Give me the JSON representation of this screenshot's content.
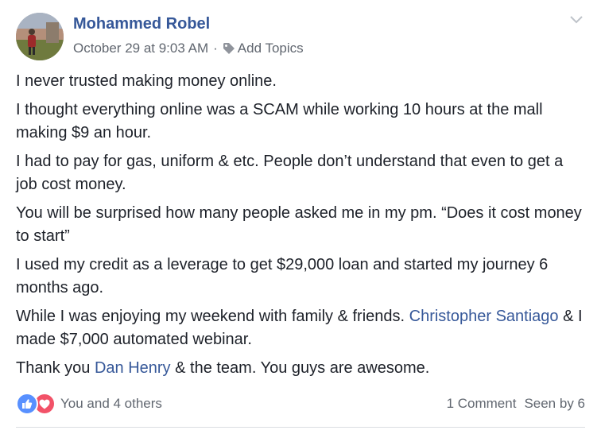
{
  "post": {
    "author": "Mohammed Robel",
    "timestamp": "October 29 at 9:03 AM",
    "separator": "·",
    "add_topics": "Add Topics",
    "menu_icon": "chevron-down-icon",
    "paragraphs": [
      "I never trusted making money online.",
      "I thought everything online was a SCAM while working 10 hours at the mall making $9 an hour.",
      "I had to pay for gas, uniform & etc. People don’t understand that even to get a job cost money.",
      "You will be surprised how many people asked me in my pm. “Does it cost money to start”",
      "I used my credit as a leverage to get $29,000 loan and started my journey 6 months ago."
    ],
    "para6": {
      "before": "While I was enjoying my weekend with family & friends. ",
      "mention": "Christopher Santiago",
      "after": " & I made $7,000 automated webinar."
    },
    "para7": {
      "before": "Thank you ",
      "mention": "Dan Henry",
      "after": " & the team. You guys are awesome."
    }
  },
  "footer": {
    "reaction_icons": [
      "like-icon",
      "love-icon"
    ],
    "reactions_text": "You and 4 others",
    "comments_text": "1 Comment",
    "seen_text": "Seen by 6"
  },
  "colors": {
    "link": "#365899",
    "text": "#1d2129",
    "meta": "#616770",
    "like": "#5890ff",
    "love": "#f25268"
  }
}
